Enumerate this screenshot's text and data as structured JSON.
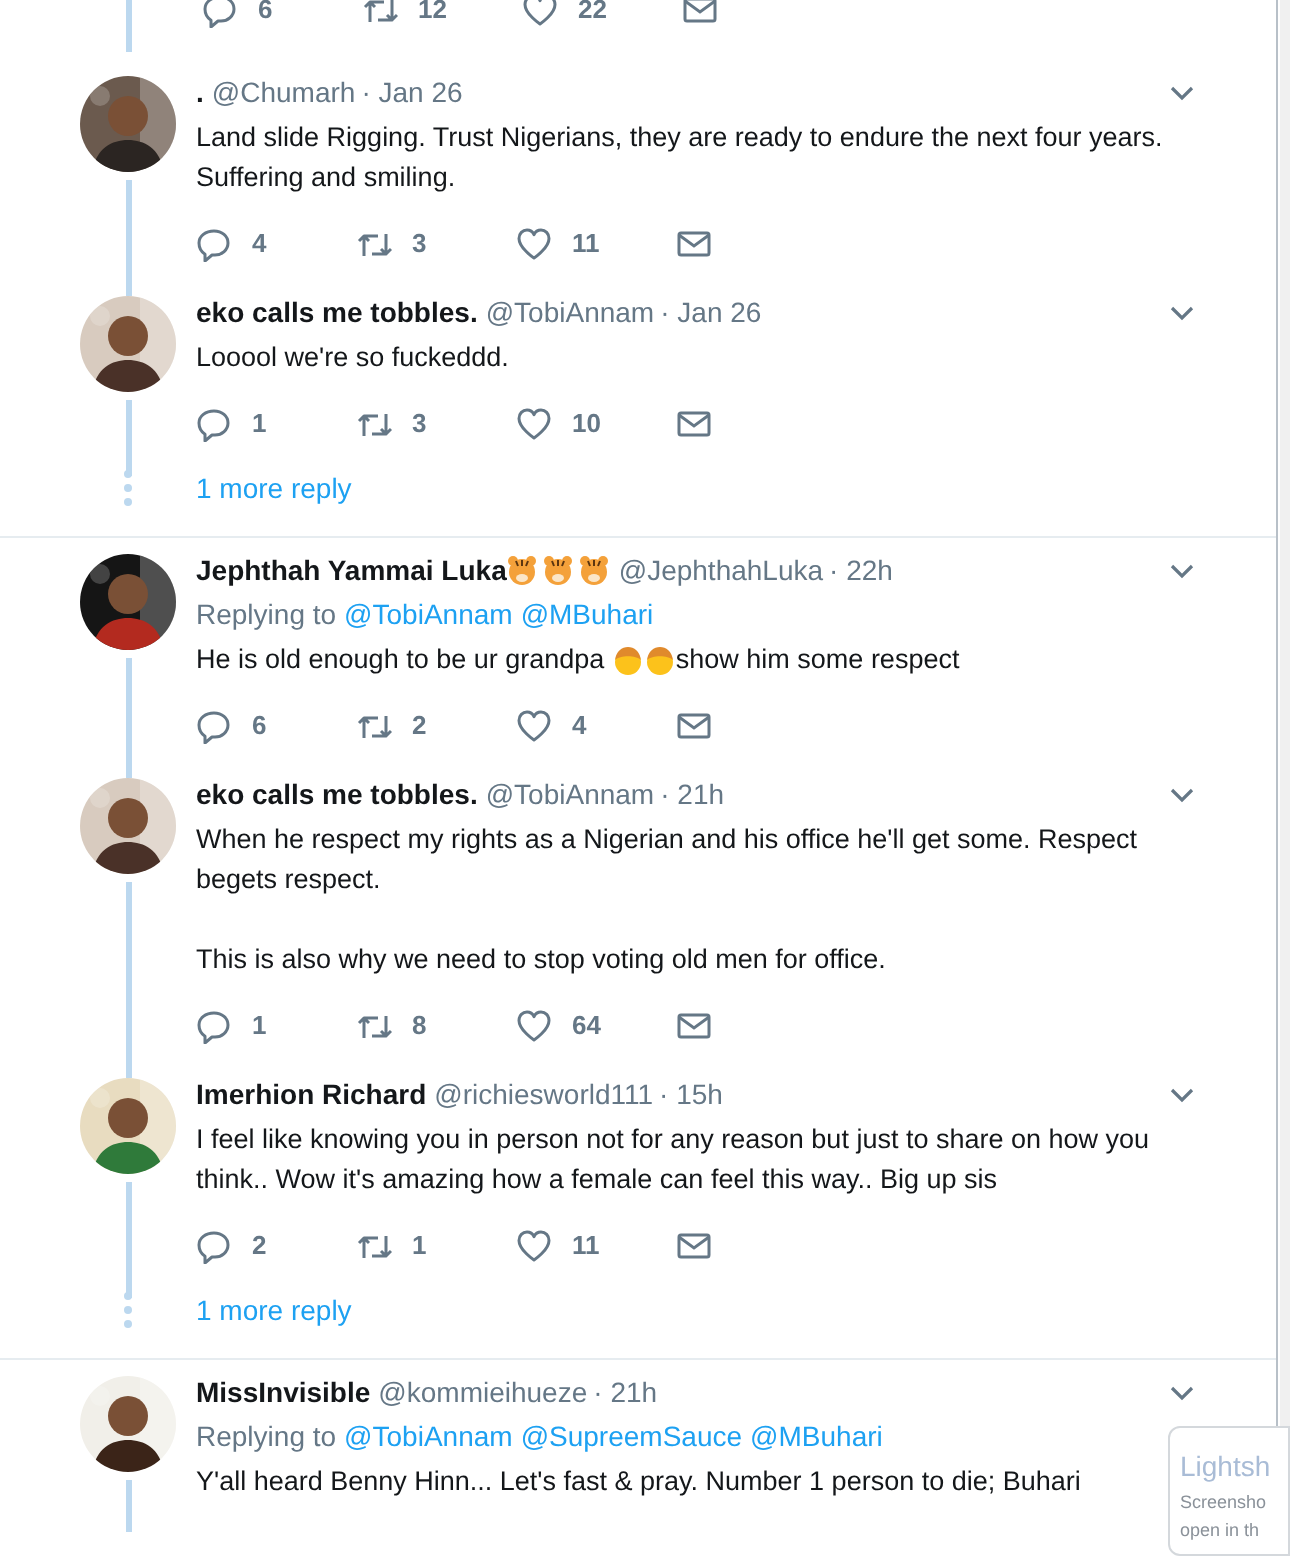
{
  "top_actions": {
    "replies": "6",
    "retweets": "12",
    "likes": "22"
  },
  "threads": [
    {
      "tweets": [
        {
          "name": ".",
          "handle": "@Chumarh",
          "time": "· Jan 26",
          "body": [
            [
              {
                "kind": "text",
                "text": "Land slide Rigging. Trust Nigerians, they are ready to endure the next four years. Suffering and smiling."
              }
            ]
          ],
          "actions": {
            "replies": "4",
            "retweets": "3",
            "likes": "11"
          }
        },
        {
          "name": "eko calls me tobbles.",
          "handle": "@TobiAnnam",
          "time": "· Jan 26",
          "body": [
            [
              {
                "kind": "text",
                "text": "Looool we're so fuckeddd."
              }
            ]
          ],
          "actions": {
            "replies": "1",
            "retweets": "3",
            "likes": "10"
          }
        }
      ],
      "more": "1 more reply"
    },
    {
      "tweets": [
        {
          "name": "Jephthah Yammai Luka",
          "name_icons": [
            {
              "kind": "tiger"
            },
            {
              "kind": "tiger"
            },
            {
              "kind": "tiger"
            }
          ],
          "handle": "@JephthahLuka",
          "time": "· 22h",
          "replying_label": "Replying to",
          "mentions": [
            "@TobiAnnam",
            "@MBuhari"
          ],
          "body": [
            [
              {
                "kind": "text",
                "text": "He is old enough to be ur grandpa "
              },
              {
                "kind": "face"
              },
              {
                "kind": "face"
              },
              {
                "kind": "text",
                "text": "show him some respect"
              }
            ]
          ],
          "actions": {
            "replies": "6",
            "retweets": "2",
            "likes": "4"
          }
        },
        {
          "name": "eko calls me tobbles.",
          "handle": "@TobiAnnam",
          "time": "· 21h",
          "body": [
            [
              {
                "kind": "text",
                "text": "When he respect my rights as a Nigerian and his office he'll get some. Respect begets respect."
              }
            ],
            [
              {
                "kind": "text",
                "text": "This is also why we need to stop voting old men for office."
              }
            ]
          ],
          "actions": {
            "replies": "1",
            "retweets": "8",
            "likes": "64"
          }
        },
        {
          "name": "Imerhion Richard",
          "handle": "@richiesworld111",
          "time": "· 15h",
          "body": [
            [
              {
                "kind": "text",
                "text": "I feel like knowing you in person not for any reason but just to share on how you think.. Wow it's amazing how a female can feel this way.. Big up sis"
              }
            ]
          ],
          "actions": {
            "replies": "2",
            "retweets": "1",
            "likes": "11"
          }
        }
      ],
      "more": "1 more reply"
    },
    {
      "tweets": [
        {
          "name": "MissInvisible",
          "handle": "@kommieihueze",
          "time": "· 21h",
          "replying_label": "Replying to",
          "mentions": [
            "@TobiAnnam",
            "@SupreemSauce",
            "@MBuhari"
          ],
          "body": [
            [
              {
                "kind": "text",
                "text": "Y'all heard Benny Hinn... Let's fast & pray. Number 1 person to die; Buhari"
              }
            ]
          ]
        }
      ]
    }
  ],
  "popup": {
    "title": "Lightsh",
    "lines": [
      "Screensho",
      "open in th"
    ]
  }
}
